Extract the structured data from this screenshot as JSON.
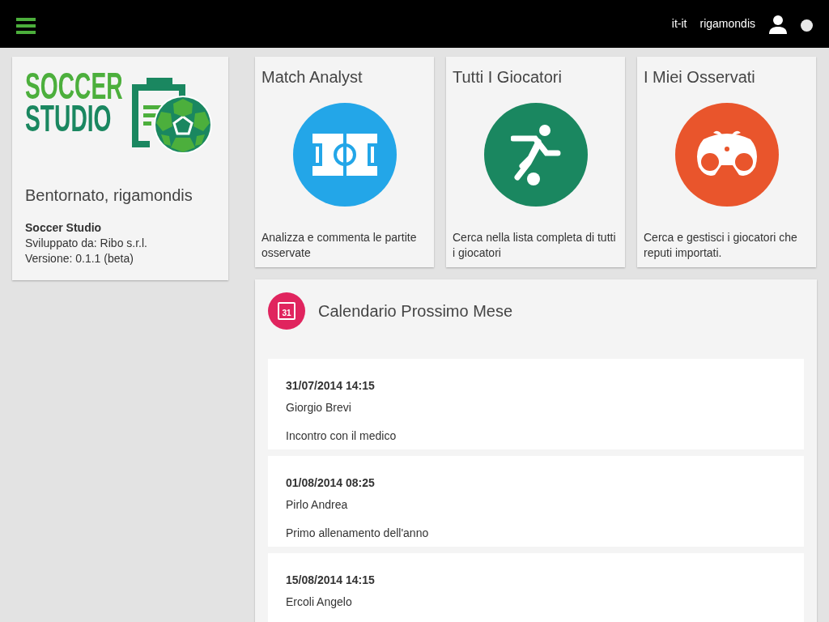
{
  "top_bar": {
    "locale": "it-it",
    "username": "rigamondis"
  },
  "app_card": {
    "logo_lines": [
      "SOCCER",
      "STUDIO"
    ],
    "welcome": "Bentornato, rigamondis",
    "app_name": "Soccer Studio",
    "developer": "Sviluppato da: Ribo s.r.l.",
    "version": "Versione: 0.1.1 (beta)"
  },
  "tiles": [
    {
      "title": "Match Analyst",
      "kind": "pitch",
      "color": "#23a6e8",
      "description": "Analizza e commenta le partite osservate"
    },
    {
      "title": "Tutti I Giocatori",
      "kind": "player",
      "color": "#1a8760",
      "description": "Cerca nella lista completa di tutti i giocatori"
    },
    {
      "title": "I Miei Osservati",
      "kind": "binoculars",
      "color": "#e9552c",
      "description": "Cerca e gestisci i giocatori che reputi importati."
    }
  ],
  "calendar": {
    "icon_day": "31",
    "title": "Calendario Prossimo Mese",
    "events": [
      {
        "datetime": "31/07/2014 14:15",
        "person": "Giorgio Brevi",
        "description": "Incontro con il medico"
      },
      {
        "datetime": "01/08/2014 08:25",
        "person": "Pirlo Andrea",
        "description": "Primo allenamento dell'anno"
      },
      {
        "datetime": "15/08/2014 14:15",
        "person": "Ercoli Angelo"
      }
    ]
  }
}
